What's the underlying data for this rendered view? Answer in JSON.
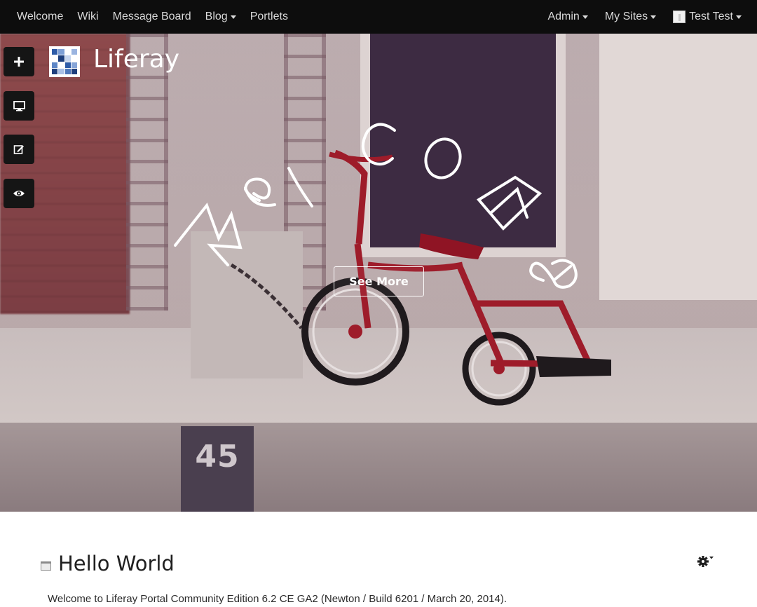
{
  "navbar": {
    "left_items": [
      {
        "label": "Welcome",
        "has_caret": false
      },
      {
        "label": "Wiki",
        "has_caret": false
      },
      {
        "label": "Message Board",
        "has_caret": false
      },
      {
        "label": "Blog",
        "has_caret": true
      },
      {
        "label": "Portlets",
        "has_caret": false
      }
    ],
    "admin_label": "Admin",
    "my_sites_label": "My Sites",
    "user_name": "Test Test"
  },
  "dockbar": [
    {
      "icon": "plus-icon"
    },
    {
      "icon": "monitor-icon"
    },
    {
      "icon": "edit-icon"
    },
    {
      "icon": "eye-icon"
    }
  ],
  "site": {
    "name": "Liferay"
  },
  "hero": {
    "welcome_letters": [
      "W",
      "e",
      "l",
      "c",
      "o",
      "m",
      "e"
    ],
    "see_more_label": "See More",
    "curb_number": "45"
  },
  "portlet": {
    "title": "Hello World",
    "body": "Welcome to Liferay Portal Community Edition 6.2 CE GA2 (Newton / Build 6201 / March 20, 2014)."
  },
  "colors": {
    "navbar_bg": "#0d0d0d",
    "navbar_text": "#d9d9d9",
    "dock_button_bg": "#151515",
    "tricycle_red": "#9e1c2a"
  }
}
